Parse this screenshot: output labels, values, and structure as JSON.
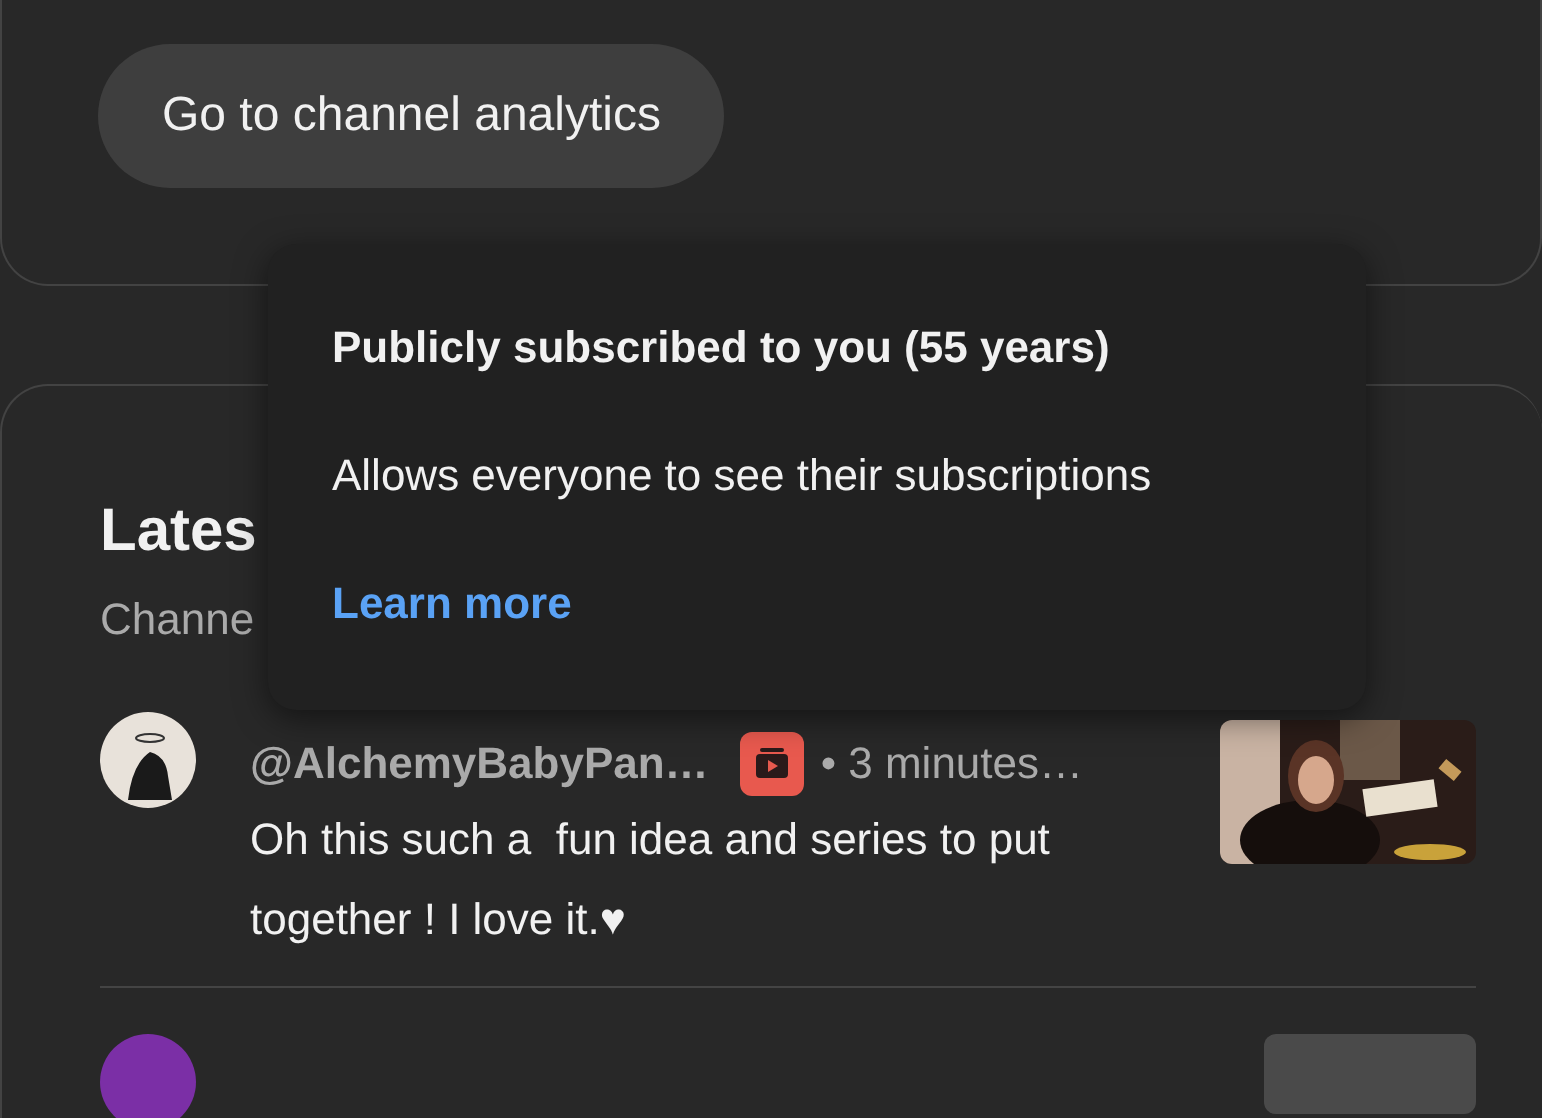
{
  "channel_card": {
    "button": "Go to channel analytics"
  },
  "tooltip": {
    "title": "Publicly subscribed to you (55 years)",
    "body": "Allows everyone to see their subscriptions",
    "link": "Learn more"
  },
  "comments_card": {
    "title": "Lates",
    "subtitle": "Channe",
    "comments": [
      {
        "author": "@AlchemyBabyPan…",
        "time": "• 3 minutes…",
        "text": "Oh this such a  fun idea and series to put together ! I love it.♥"
      }
    ]
  }
}
